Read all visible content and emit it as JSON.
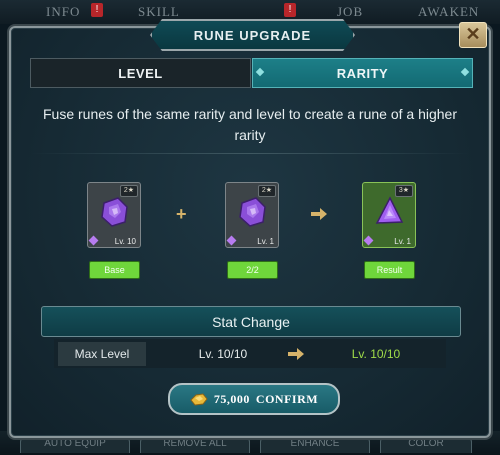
{
  "background": {
    "tabs": [
      "INFO",
      "SKILL",
      "JOB",
      "AWAKEN"
    ],
    "alert_glyph": "!",
    "bottom_buttons": [
      "AUTO EQUIP",
      "REMOVE ALL",
      "ENHANCE",
      "COLOR"
    ]
  },
  "dialog": {
    "title": "RUNE UPGRADE",
    "close_glyph": "✕",
    "tabs": [
      {
        "label": "LEVEL",
        "active": false
      },
      {
        "label": "RARITY",
        "active": true
      }
    ],
    "description": "Fuse runes of the same rarity and level to create a rune of a higher rarity",
    "fusion": {
      "plus_glyph": "+",
      "runes": [
        {
          "stars": "2★",
          "level": "Lv. 10",
          "label": "Base",
          "gem_color": "#8a4fd8",
          "shape": "stone"
        },
        {
          "stars": "2★",
          "level": "Lv. 1",
          "label": "2/2",
          "gem_color": "#8a4fd8",
          "shape": "stone"
        },
        {
          "stars": "3★",
          "level": "Lv. 1",
          "label": "Result",
          "gem_color": "#a05ef0",
          "shape": "triangle"
        }
      ]
    },
    "stat_change": {
      "header": "Stat Change",
      "rows": [
        {
          "name": "Max Level",
          "from": "Lv. 10/10",
          "to": "Lv. 10/10"
        }
      ]
    },
    "confirm": {
      "cost": "75,000",
      "label": "CONFIRM",
      "currency_icon": "gold-icon"
    }
  },
  "colors": {
    "accent_teal": "#136a73",
    "result_green": "#6fd63b",
    "gold": "#d6b36a",
    "new_value": "#9fdc49"
  }
}
